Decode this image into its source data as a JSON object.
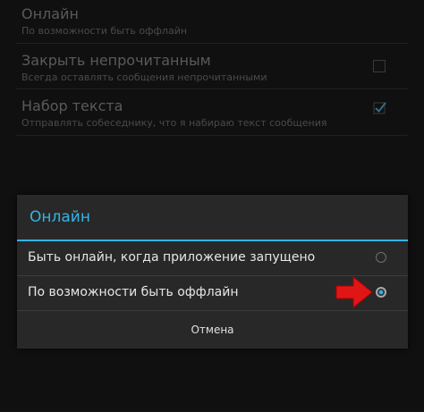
{
  "settings": [
    {
      "title": "Онлайн",
      "subtitle": "По возможности быть оффлайн",
      "control": "none"
    },
    {
      "title": "Закрыть непрочитанным",
      "subtitle": "Всегда оставлять сообщения непрочитанными",
      "control": "checkbox",
      "checked": false
    },
    {
      "title": "Набор текста",
      "subtitle": "Отправлять собеседнику, что я набираю текст сообщения",
      "control": "checkbox",
      "checked": true
    }
  ],
  "dialog": {
    "title": "Онлайн",
    "options": [
      {
        "label": "Быть онлайн, когда приложение запущено",
        "selected": false
      },
      {
        "label": "По возможности быть оффлайн",
        "selected": true
      }
    ],
    "cancel_label": "Отмена"
  },
  "colors": {
    "accent": "#33b5e5",
    "annotation_arrow": "#e01616",
    "dialog_bg": "#282828",
    "screen_bg": "#101010"
  },
  "icons": {
    "annotation": "red-arrow-right-icon",
    "checked": "check-mark-icon"
  }
}
